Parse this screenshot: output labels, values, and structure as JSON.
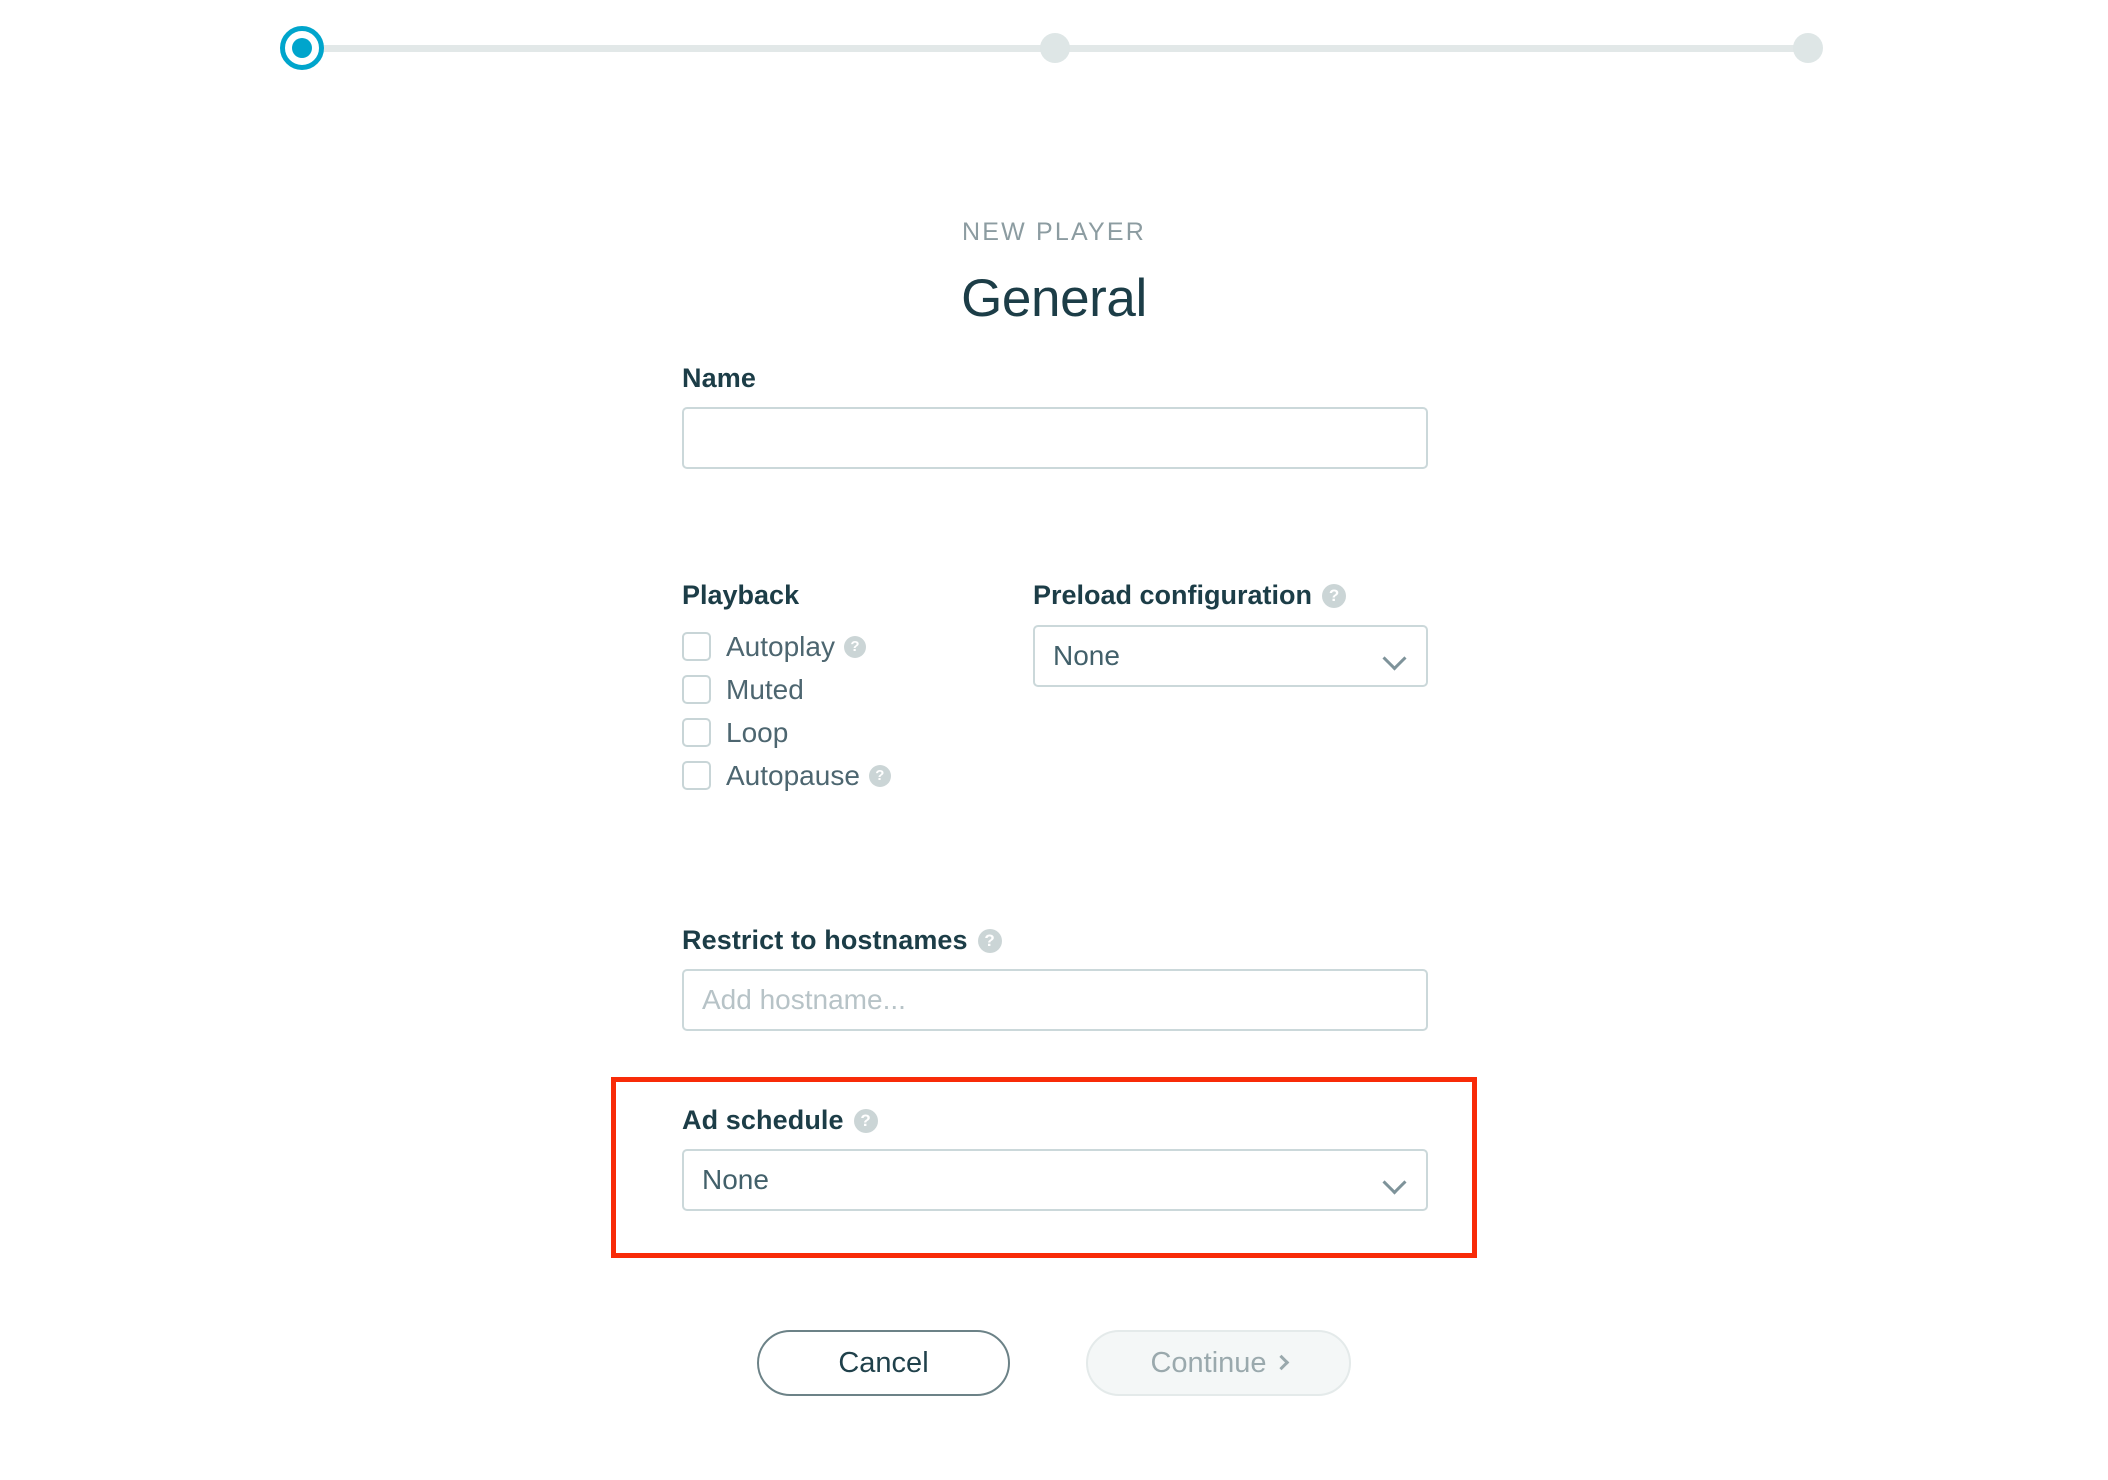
{
  "stepper": {
    "steps": [
      {
        "label": "step-1",
        "state": "active"
      },
      {
        "label": "step-2",
        "state": "inactive"
      },
      {
        "label": "step-3",
        "state": "inactive"
      }
    ],
    "active_color": "#00A5CC",
    "inactive_color": "#DEE6E6"
  },
  "header": {
    "eyebrow": "NEW PLAYER",
    "title": "General"
  },
  "name": {
    "label": "Name",
    "value": "",
    "placeholder": ""
  },
  "playback": {
    "heading": "Playback",
    "options": [
      {
        "label": "Autoplay",
        "checked": false,
        "help": true
      },
      {
        "label": "Muted",
        "checked": false,
        "help": false
      },
      {
        "label": "Loop",
        "checked": false,
        "help": false
      },
      {
        "label": "Autopause",
        "checked": false,
        "help": true
      }
    ]
  },
  "preload": {
    "label": "Preload configuration",
    "value": "None",
    "help": true
  },
  "hostnames": {
    "label": "Restrict to hostnames",
    "value": "",
    "placeholder": "Add hostname...",
    "help": true
  },
  "ad_schedule": {
    "label": "Ad schedule",
    "value": "None",
    "help": true,
    "highlight_color": "#F82B08"
  },
  "footer": {
    "cancel_label": "Cancel",
    "continue_label": "Continue",
    "continue_disabled": true
  },
  "icons": {
    "help": "?",
    "chevron_down": "chevron-down-icon",
    "chevron_right": "chevron-right-icon"
  }
}
